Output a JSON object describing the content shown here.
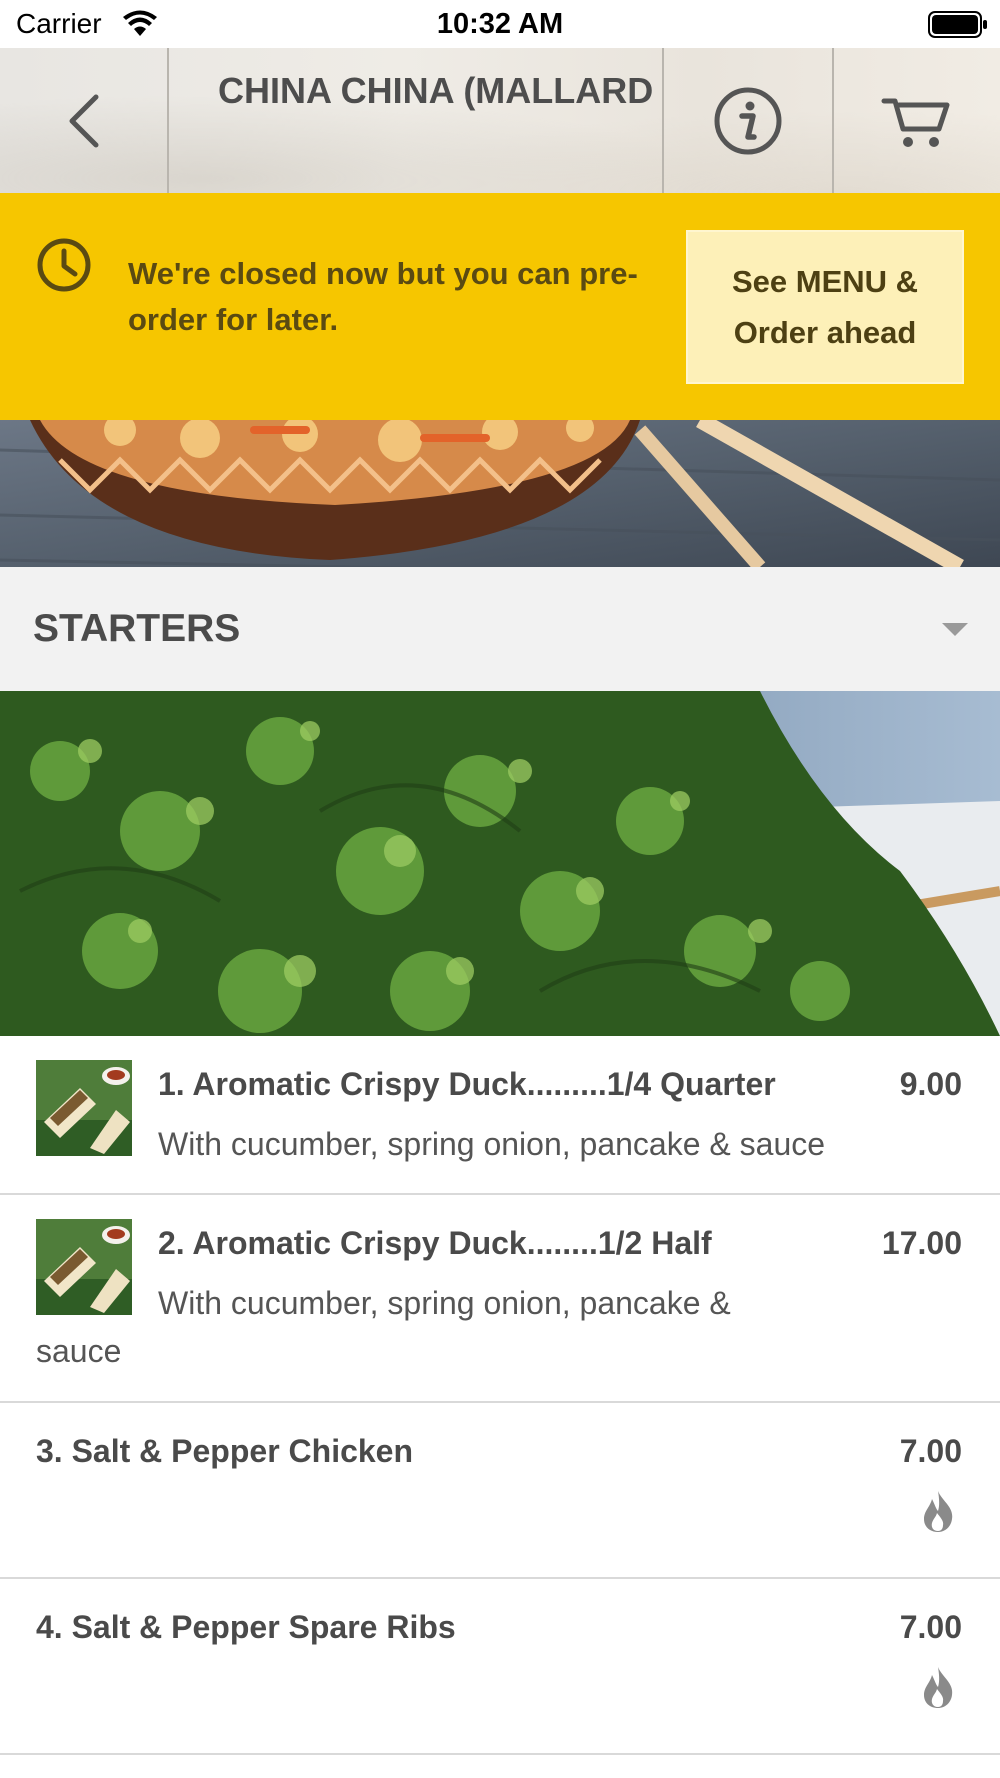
{
  "status_bar": {
    "carrier": "Carrier",
    "time": "10:32 AM"
  },
  "header": {
    "title": "CHINA CHINA (MALLARD",
    "back_icon": "chevron-left-icon",
    "info_icon": "info-icon",
    "cart_icon": "cart-icon"
  },
  "banner": {
    "message": "We're closed now but you can pre-order for later.",
    "button_label": "See MENU & Order ahead",
    "icon": "clock-icon",
    "color": "#f6c600"
  },
  "section": {
    "title": "STARTERS",
    "icon": "caret-down-icon"
  },
  "menu_items": [
    {
      "name": "1. Aromatic Crispy Duck.........1/4 Quarter",
      "description": "With cucumber, spring onion, pancake & sauce",
      "price": "9.00"
    },
    {
      "name": "2. Aromatic Crispy Duck........1/2 Half",
      "description": "With cucumber, spring onion, pancake & sauce",
      "price": "17.00"
    },
    {
      "name": "3. Salt & Pepper Chicken",
      "description": "",
      "price": "7.00",
      "icon": "chili-icon"
    },
    {
      "name": "4. Salt & Pepper Spare Ribs",
      "description": "",
      "price": "7.00",
      "icon": "chili-icon"
    }
  ]
}
